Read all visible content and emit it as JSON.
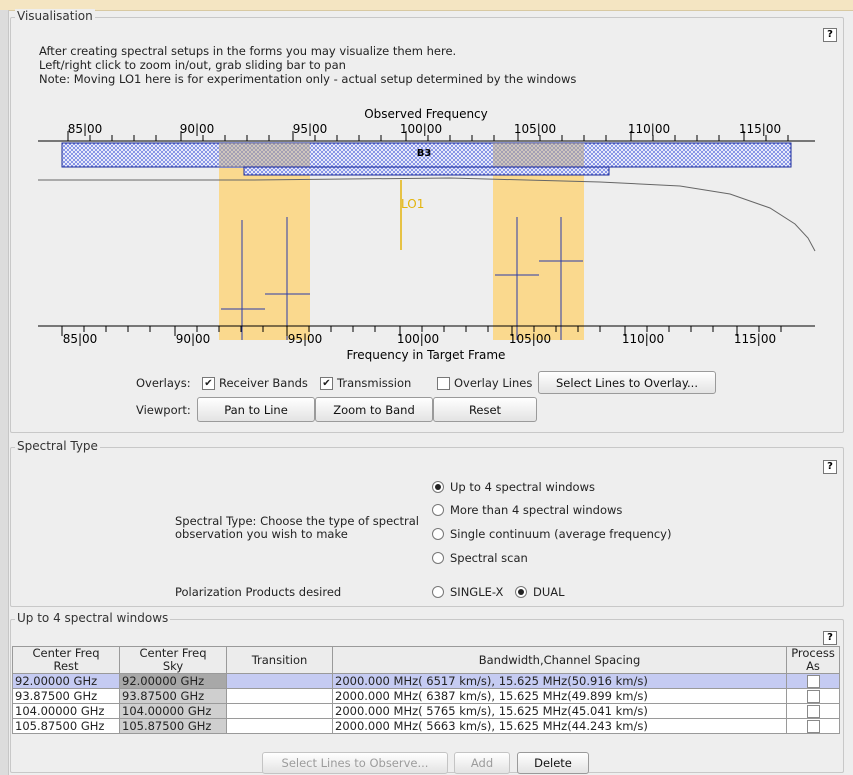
{
  "visualisation": {
    "legend": "Visualisation",
    "help": "?",
    "intro": [
      "After creating spectral setups in the forms you may visualize them here.",
      "Left/right click to zoom in/out, grab sliding bar to pan",
      "Note: Moving LO1 here is for experimentation only - actual setup determined by the windows"
    ],
    "top_axis_title": "Observed Frequency",
    "bottom_axis_title": "Frequency in Target Frame",
    "band_label": "B3",
    "lo_label": "LO1",
    "tick_labels": [
      "85|00",
      "90|00",
      "95|00",
      "100|00",
      "105|00",
      "110|00",
      "115|00"
    ],
    "overlays_label": "Overlays:",
    "receiver_bands": {
      "label": "Receiver Bands",
      "checked": true
    },
    "transmission": {
      "label": "Transmission",
      "checked": true
    },
    "overlay_lines": {
      "label": "Overlay Lines",
      "checked": false
    },
    "select_lines_overlay_button": "Select Lines to Overlay...",
    "viewport_label": "Viewport:",
    "pan_button": "Pan to Line",
    "zoom_button": "Zoom to Band",
    "reset_button": "Reset",
    "colors": {
      "band_fill": "#4d63d6",
      "sideband": "#fad98e",
      "window_line": "#2a3ca8",
      "lo": "#e3b40c"
    }
  },
  "spectral_type": {
    "legend": "Spectral Type",
    "help": "?",
    "prompt_line1": "Spectral Type: Choose the type of spectral",
    "prompt_line2": "observation you wish to make",
    "options": [
      {
        "label": "Up to 4 spectral windows",
        "selected": true
      },
      {
        "label": "More than 4 spectral windows",
        "selected": false
      },
      {
        "label": "Single continuum (average frequency)",
        "selected": false
      },
      {
        "label": "Spectral scan",
        "selected": false
      }
    ],
    "polarization_label": "Polarization Products desired",
    "polarization_options": [
      {
        "label": "SINGLE-X",
        "selected": false
      },
      {
        "label": "DUAL",
        "selected": true
      }
    ]
  },
  "windows": {
    "legend": "Up to 4 spectral windows",
    "help": "?",
    "headers": {
      "rest_line1": "Center Freq",
      "rest_line2": "Rest",
      "sky_line1": "Center Freq",
      "sky_line2": "Sky",
      "transition": "Transition",
      "bandwidth": "Bandwidth,Channel Spacing",
      "process_line1": "Process",
      "process_line2": "As"
    },
    "rows": [
      {
        "rest": "92.00000 GHz",
        "sky": "92.00000 GHz",
        "transition": "",
        "bandwidth": "2000.000 MHz( 6517 km/s),  15.625 MHz(50.916 km/s)"
      },
      {
        "rest": "93.87500 GHz",
        "sky": "93.87500 GHz",
        "transition": "",
        "bandwidth": "2000.000 MHz( 6387 km/s),  15.625 MHz(49.899 km/s)"
      },
      {
        "rest": "104.00000 GHz",
        "sky": "104.00000 GHz",
        "transition": "",
        "bandwidth": "2000.000 MHz( 5765 km/s),  15.625 MHz(45.041 km/s)"
      },
      {
        "rest": "105.87500 GHz",
        "sky": "105.87500 GHz",
        "transition": "",
        "bandwidth": "2000.000 MHz( 5663 km/s),  15.625 MHz(44.243 km/s)"
      }
    ],
    "select_lines_observe_button": "Select Lines to Observe...",
    "add_button": "Add",
    "delete_button": "Delete"
  }
}
